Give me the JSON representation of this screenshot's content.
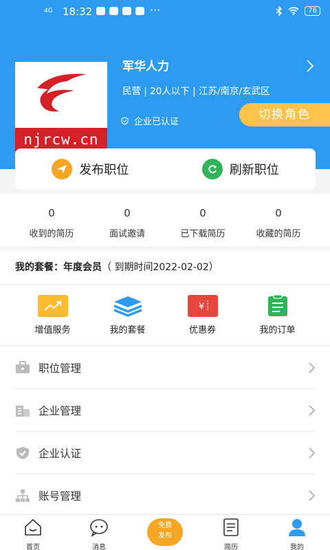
{
  "status_bar": {
    "network": "4G",
    "time": "18:32",
    "dots": "···",
    "battery": "76"
  },
  "company": {
    "name": "军华人力",
    "info": "民营 | 20人以下 | 江苏/南京/玄武区",
    "verified_label": "企业已认证",
    "logo_domain": "njrcw.cn"
  },
  "switch_role_label": "切换角色",
  "actions": {
    "publish": "发布职位",
    "refresh": "刷新职位"
  },
  "stats": [
    {
      "value": "0",
      "label": "收到的简历"
    },
    {
      "value": "0",
      "label": "面试邀请"
    },
    {
      "value": "0",
      "label": "已下载简历"
    },
    {
      "value": "0",
      "label": "收藏的简历"
    }
  ],
  "package": {
    "prefix": "我的套餐：",
    "level": "年度会员",
    "expiry": "（ 到期时间2022-02-02）"
  },
  "services": [
    {
      "label": "增值服务",
      "icon": "trend-chart-icon",
      "color": "#fdbb2d"
    },
    {
      "label": "我的套餐",
      "icon": "layers-icon",
      "color": "#2d9cf0"
    },
    {
      "label": "优惠券",
      "icon": "coupon-icon",
      "color": "#e8453c"
    },
    {
      "label": "我的订单",
      "icon": "clipboard-icon",
      "color": "#2fb45a"
    }
  ],
  "menu": [
    {
      "label": "职位管理",
      "icon": "briefcase-icon"
    },
    {
      "label": "企业管理",
      "icon": "building-icon"
    },
    {
      "label": "企业认证",
      "icon": "shield-check-icon"
    },
    {
      "label": "账号管理",
      "icon": "org-chart-icon"
    }
  ],
  "tabbar": {
    "home": "首页",
    "messages": "消息",
    "center_line1": "免费",
    "center_line2": "发布",
    "resume": "简历",
    "mine": "我的"
  },
  "colors": {
    "primary": "#2d9cf0",
    "accent": "#fdc24a",
    "center_button": "#f6a623"
  }
}
